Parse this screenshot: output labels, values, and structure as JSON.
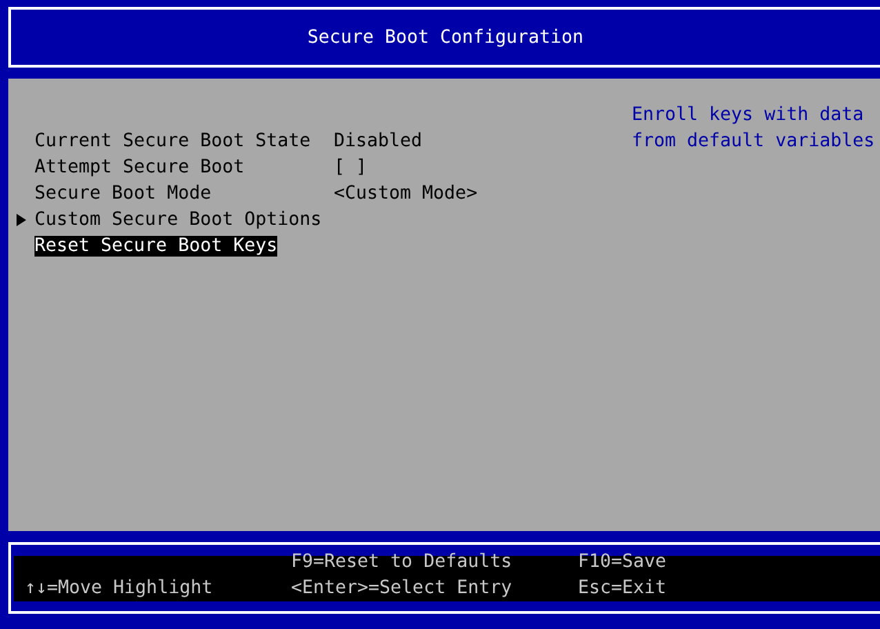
{
  "window": {
    "title": "Secure Boot Configuration"
  },
  "items": [
    {
      "label": "Current Secure Boot State",
      "value": "Disabled",
      "submenu": false,
      "selected": false
    },
    {
      "label": "Attempt Secure Boot",
      "value": "[ ]",
      "submenu": false,
      "selected": false
    },
    {
      "label": "Secure Boot Mode",
      "value": "<Custom Mode>",
      "submenu": false,
      "selected": false
    },
    {
      "label": "Custom Secure Boot Options",
      "submenu": true,
      "selected": false
    },
    {
      "label": "Reset Secure Boot Keys",
      "submenu": false,
      "selected": true
    }
  ],
  "help": [
    "Enroll keys with data",
    "from default variables"
  ],
  "footer": [
    {
      "lines": [
        "↑↓=Move Highlight"
      ]
    },
    {
      "lines": [
        "F9=Reset to Defaults",
        "<Enter>=Select Entry"
      ]
    },
    {
      "lines": [
        "F10=Save",
        "Esc=Exit"
      ]
    }
  ]
}
